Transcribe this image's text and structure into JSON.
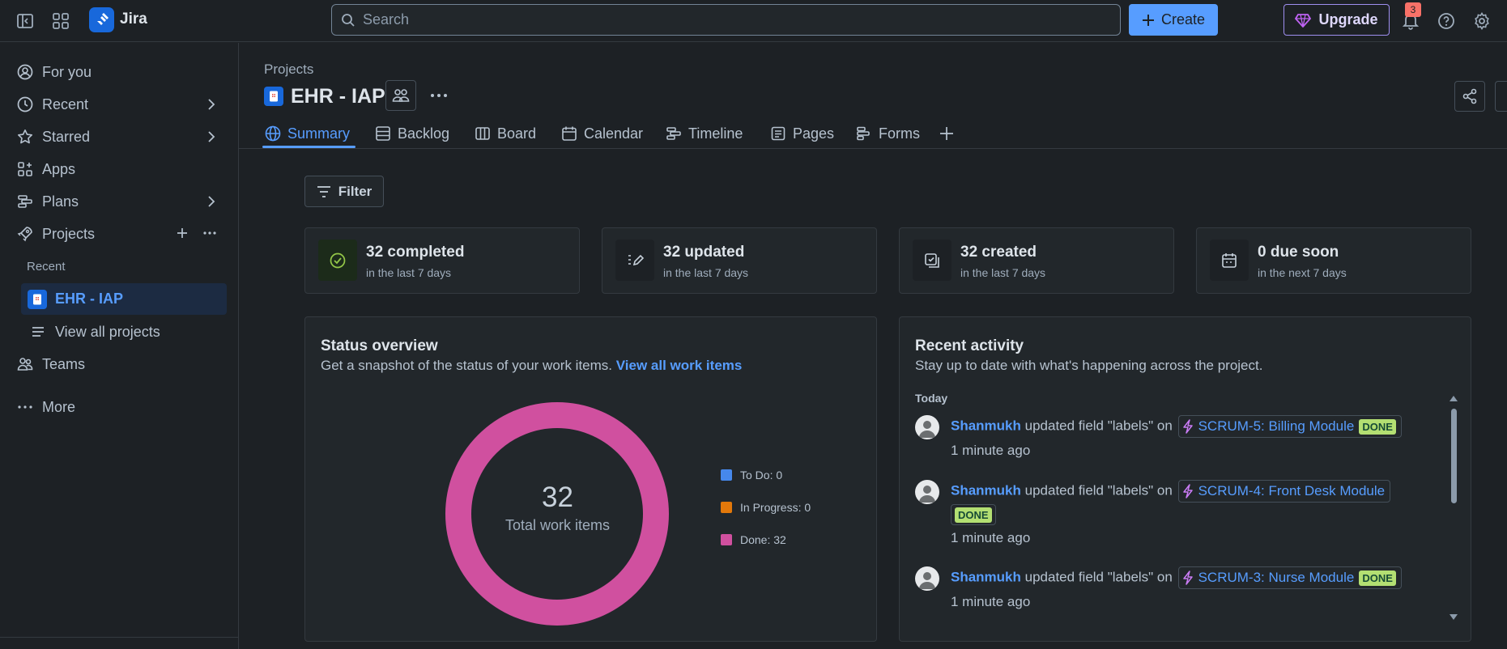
{
  "topbar": {
    "app_name": "Jira",
    "search_placeholder": "Search",
    "create_label": "Create",
    "upgrade_label": "Upgrade",
    "notification_count": "3"
  },
  "sidebar": {
    "items": [
      {
        "label": "For you",
        "icon": "user-circle-icon"
      },
      {
        "label": "Recent",
        "icon": "clock-icon"
      },
      {
        "label": "Starred",
        "icon": "star-icon"
      },
      {
        "label": "Apps",
        "icon": "apps-icon"
      },
      {
        "label": "Plans",
        "icon": "plans-icon"
      },
      {
        "label": "Projects",
        "icon": "rocket-icon"
      }
    ],
    "recent_heading": "Recent",
    "active_project": "EHR - IAP",
    "view_all": "View all projects",
    "teams": "Teams",
    "more": "More"
  },
  "header": {
    "breadcrumb": "Projects",
    "project_title": "EHR - IAP"
  },
  "tabs": [
    {
      "label": "Summary",
      "icon": "globe-icon"
    },
    {
      "label": "Backlog",
      "icon": "backlog-icon"
    },
    {
      "label": "Board",
      "icon": "board-icon"
    },
    {
      "label": "Calendar",
      "icon": "calendar-icon"
    },
    {
      "label": "Timeline",
      "icon": "timeline-icon"
    },
    {
      "label": "Pages",
      "icon": "pages-icon"
    },
    {
      "label": "Forms",
      "icon": "forms-icon"
    }
  ],
  "filter_label": "Filter",
  "stats": [
    {
      "title": "32 completed",
      "subtitle": "in the last 7 days",
      "icon": "check-circle-icon"
    },
    {
      "title": "32 updated",
      "subtitle": "in the last 7 days",
      "icon": "edit-icon"
    },
    {
      "title": "32 created",
      "subtitle": "in the last 7 days",
      "icon": "created-icon"
    },
    {
      "title": "0 due soon",
      "subtitle": "in the next 7 days",
      "icon": "calendar-icon"
    }
  ],
  "status_overview": {
    "title": "Status overview",
    "subtitle": "Get a snapshot of the status of your work items.",
    "link": "View all work items",
    "total": "32",
    "total_label": "Total work items",
    "legend": [
      {
        "label": "To Do: 0",
        "value": 0,
        "color": "#4688ec"
      },
      {
        "label": "In Progress: 0",
        "value": 0,
        "color": "#e2780a"
      },
      {
        "label": "Done: 32",
        "value": 32,
        "color": "#d0509f"
      }
    ]
  },
  "recent_activity": {
    "title": "Recent activity",
    "subtitle": "Stay up to date with what's happening across the project.",
    "day": "Today",
    "items": [
      {
        "user": "Shanmukh",
        "action": "updated field \"labels\" on",
        "issue": "SCRUM-5: Billing Module",
        "status": "DONE",
        "time": "1 minute ago"
      },
      {
        "user": "Shanmukh",
        "action": "updated field \"labels\" on",
        "issue": "SCRUM-4: Front Desk Module",
        "status": "DONE",
        "time": "1 minute ago"
      },
      {
        "user": "Shanmukh",
        "action": "updated field \"labels\" on",
        "issue": "SCRUM-3: Nurse Module",
        "status": "DONE",
        "time": "1 minute ago"
      }
    ]
  }
}
